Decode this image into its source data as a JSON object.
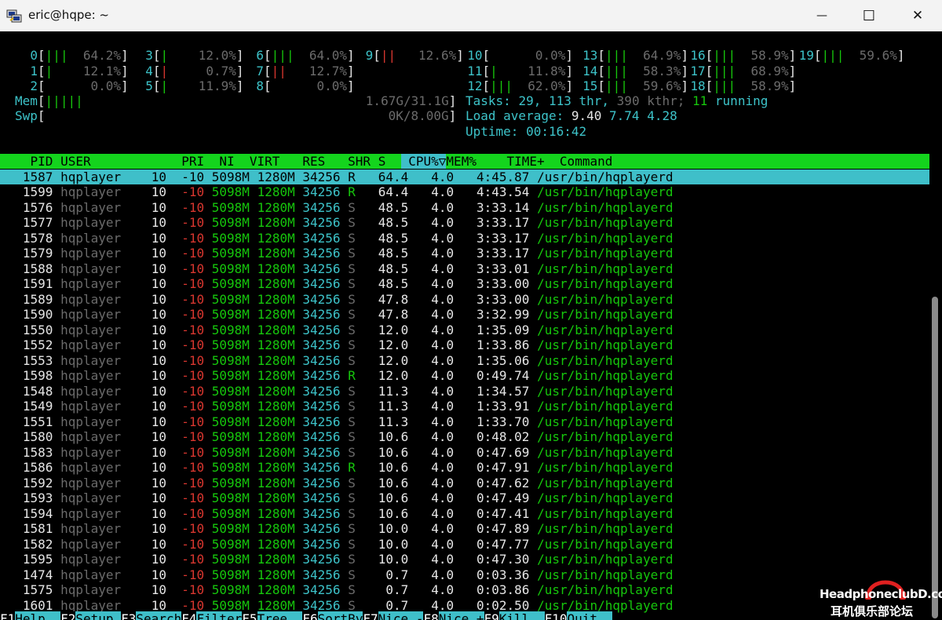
{
  "window": {
    "title": "eric@hqpe: ~",
    "minimize_glyph": "—",
    "maximize_glyph": "☐",
    "close_glyph": "✕",
    "app_icon": "putty-icon"
  },
  "meters": {
    "cpus": [
      {
        "id": "0",
        "bars": "|||",
        "pct": "64.2%"
      },
      {
        "id": "1",
        "bars": "|",
        "pct": "12.1%"
      },
      {
        "id": "2",
        "bars": "",
        "pct": "0.0%"
      },
      {
        "id": "3",
        "bars": "|",
        "pct": "12.0%"
      },
      {
        "id": "4",
        "bars": "|",
        "pct": "0.7%"
      },
      {
        "id": "5",
        "bars": "|",
        "pct": "11.9%"
      },
      {
        "id": "6",
        "bars": "|||",
        "pct": "64.0%"
      },
      {
        "id": "7",
        "bars": "||",
        "pct": "12.7%"
      },
      {
        "id": "8",
        "bars": "",
        "pct": "0.0%"
      },
      {
        "id": "9",
        "bars": "||",
        "pct": "12.6%"
      },
      {
        "id": "10",
        "bars": "",
        "pct": "0.0%"
      },
      {
        "id": "11",
        "bars": "|",
        "pct": "11.8%"
      },
      {
        "id": "12",
        "bars": "|||",
        "pct": "62.0%"
      },
      {
        "id": "13",
        "bars": "|||",
        "pct": "64.9%"
      },
      {
        "id": "14",
        "bars": "|||",
        "pct": "58.3%"
      },
      {
        "id": "15",
        "bars": "|||",
        "pct": "59.6%"
      },
      {
        "id": "16",
        "bars": "|||",
        "pct": "58.9%"
      },
      {
        "id": "17",
        "bars": "|||",
        "pct": "68.9%"
      },
      {
        "id": "18",
        "bars": "|||",
        "pct": "58.9%"
      },
      {
        "id": "19",
        "bars": "|||",
        "pct": "59.6%"
      }
    ],
    "mem": {
      "label": "Mem",
      "bars": "|||||",
      "value": "1.67G/31.1G"
    },
    "swp": {
      "label": "Swp",
      "bars": "",
      "value": "0K/8.00G"
    }
  },
  "summary": {
    "tasks_label": "Tasks: ",
    "tasks": "29",
    "sep1": ", ",
    "thr": "113",
    "thr_label": " thr, ",
    "kthr": "390",
    "kthr_label": " kthr; ",
    "running": "11",
    "running_label": " running",
    "load_label": "Load average: ",
    "load1": "9.40",
    "load5": "7.74",
    "load15": "4.28",
    "uptime_label": "Uptime: ",
    "uptime": "00:16:42"
  },
  "table": {
    "headers": {
      "pid": "PID",
      "user": "USER",
      "pri": "PRI",
      "ni": "NI",
      "virt": "VIRT",
      "res": "RES",
      "shr": "SHR",
      "s": "S",
      "cpu": "CPU%",
      "sort_arrow": "▽",
      "mem": "MEM%",
      "time": "TIME+",
      "command": "Command"
    },
    "rows": [
      {
        "pid": "1587",
        "user": "hqplayer",
        "pri": "10",
        "ni": "-10",
        "virt": "5098M",
        "res": "1280M",
        "shr": "34256",
        "s": "R",
        "cpu": "64.4",
        "mem": "4.0",
        "time": "4:45.87",
        "command": "/usr/bin/hqplayerd"
      },
      {
        "pid": "1599",
        "user": "hqplayer",
        "pri": "10",
        "ni": "-10",
        "virt": "5098M",
        "res": "1280M",
        "shr": "34256",
        "s": "R",
        "cpu": "64.4",
        "mem": "4.0",
        "time": "4:43.54",
        "command": "/usr/bin/hqplayerd"
      },
      {
        "pid": "1576",
        "user": "hqplayer",
        "pri": "10",
        "ni": "-10",
        "virt": "5098M",
        "res": "1280M",
        "shr": "34256",
        "s": "S",
        "cpu": "48.5",
        "mem": "4.0",
        "time": "3:33.14",
        "command": "/usr/bin/hqplayerd"
      },
      {
        "pid": "1577",
        "user": "hqplayer",
        "pri": "10",
        "ni": "-10",
        "virt": "5098M",
        "res": "1280M",
        "shr": "34256",
        "s": "S",
        "cpu": "48.5",
        "mem": "4.0",
        "time": "3:33.17",
        "command": "/usr/bin/hqplayerd"
      },
      {
        "pid": "1578",
        "user": "hqplayer",
        "pri": "10",
        "ni": "-10",
        "virt": "5098M",
        "res": "1280M",
        "shr": "34256",
        "s": "S",
        "cpu": "48.5",
        "mem": "4.0",
        "time": "3:33.17",
        "command": "/usr/bin/hqplayerd"
      },
      {
        "pid": "1579",
        "user": "hqplayer",
        "pri": "10",
        "ni": "-10",
        "virt": "5098M",
        "res": "1280M",
        "shr": "34256",
        "s": "S",
        "cpu": "48.5",
        "mem": "4.0",
        "time": "3:33.17",
        "command": "/usr/bin/hqplayerd"
      },
      {
        "pid": "1588",
        "user": "hqplayer",
        "pri": "10",
        "ni": "-10",
        "virt": "5098M",
        "res": "1280M",
        "shr": "34256",
        "s": "S",
        "cpu": "48.5",
        "mem": "4.0",
        "time": "3:33.01",
        "command": "/usr/bin/hqplayerd"
      },
      {
        "pid": "1591",
        "user": "hqplayer",
        "pri": "10",
        "ni": "-10",
        "virt": "5098M",
        "res": "1280M",
        "shr": "34256",
        "s": "S",
        "cpu": "48.5",
        "mem": "4.0",
        "time": "3:33.00",
        "command": "/usr/bin/hqplayerd"
      },
      {
        "pid": "1589",
        "user": "hqplayer",
        "pri": "10",
        "ni": "-10",
        "virt": "5098M",
        "res": "1280M",
        "shr": "34256",
        "s": "S",
        "cpu": "47.8",
        "mem": "4.0",
        "time": "3:33.00",
        "command": "/usr/bin/hqplayerd"
      },
      {
        "pid": "1590",
        "user": "hqplayer",
        "pri": "10",
        "ni": "-10",
        "virt": "5098M",
        "res": "1280M",
        "shr": "34256",
        "s": "S",
        "cpu": "47.8",
        "mem": "4.0",
        "time": "3:32.99",
        "command": "/usr/bin/hqplayerd"
      },
      {
        "pid": "1550",
        "user": "hqplayer",
        "pri": "10",
        "ni": "-10",
        "virt": "5098M",
        "res": "1280M",
        "shr": "34256",
        "s": "S",
        "cpu": "12.0",
        "mem": "4.0",
        "time": "1:35.09",
        "command": "/usr/bin/hqplayerd"
      },
      {
        "pid": "1552",
        "user": "hqplayer",
        "pri": "10",
        "ni": "-10",
        "virt": "5098M",
        "res": "1280M",
        "shr": "34256",
        "s": "S",
        "cpu": "12.0",
        "mem": "4.0",
        "time": "1:33.86",
        "command": "/usr/bin/hqplayerd"
      },
      {
        "pid": "1553",
        "user": "hqplayer",
        "pri": "10",
        "ni": "-10",
        "virt": "5098M",
        "res": "1280M",
        "shr": "34256",
        "s": "S",
        "cpu": "12.0",
        "mem": "4.0",
        "time": "1:35.06",
        "command": "/usr/bin/hqplayerd"
      },
      {
        "pid": "1598",
        "user": "hqplayer",
        "pri": "10",
        "ni": "-10",
        "virt": "5098M",
        "res": "1280M",
        "shr": "34256",
        "s": "R",
        "cpu": "12.0",
        "mem": "4.0",
        "time": "0:49.74",
        "command": "/usr/bin/hqplayerd"
      },
      {
        "pid": "1548",
        "user": "hqplayer",
        "pri": "10",
        "ni": "-10",
        "virt": "5098M",
        "res": "1280M",
        "shr": "34256",
        "s": "S",
        "cpu": "11.3",
        "mem": "4.0",
        "time": "1:34.57",
        "command": "/usr/bin/hqplayerd"
      },
      {
        "pid": "1549",
        "user": "hqplayer",
        "pri": "10",
        "ni": "-10",
        "virt": "5098M",
        "res": "1280M",
        "shr": "34256",
        "s": "S",
        "cpu": "11.3",
        "mem": "4.0",
        "time": "1:33.91",
        "command": "/usr/bin/hqplayerd"
      },
      {
        "pid": "1551",
        "user": "hqplayer",
        "pri": "10",
        "ni": "-10",
        "virt": "5098M",
        "res": "1280M",
        "shr": "34256",
        "s": "S",
        "cpu": "11.3",
        "mem": "4.0",
        "time": "1:33.70",
        "command": "/usr/bin/hqplayerd"
      },
      {
        "pid": "1580",
        "user": "hqplayer",
        "pri": "10",
        "ni": "-10",
        "virt": "5098M",
        "res": "1280M",
        "shr": "34256",
        "s": "S",
        "cpu": "10.6",
        "mem": "4.0",
        "time": "0:48.02",
        "command": "/usr/bin/hqplayerd"
      },
      {
        "pid": "1583",
        "user": "hqplayer",
        "pri": "10",
        "ni": "-10",
        "virt": "5098M",
        "res": "1280M",
        "shr": "34256",
        "s": "S",
        "cpu": "10.6",
        "mem": "4.0",
        "time": "0:47.69",
        "command": "/usr/bin/hqplayerd"
      },
      {
        "pid": "1586",
        "user": "hqplayer",
        "pri": "10",
        "ni": "-10",
        "virt": "5098M",
        "res": "1280M",
        "shr": "34256",
        "s": "R",
        "cpu": "10.6",
        "mem": "4.0",
        "time": "0:47.91",
        "command": "/usr/bin/hqplayerd"
      },
      {
        "pid": "1592",
        "user": "hqplayer",
        "pri": "10",
        "ni": "-10",
        "virt": "5098M",
        "res": "1280M",
        "shr": "34256",
        "s": "S",
        "cpu": "10.6",
        "mem": "4.0",
        "time": "0:47.62",
        "command": "/usr/bin/hqplayerd"
      },
      {
        "pid": "1593",
        "user": "hqplayer",
        "pri": "10",
        "ni": "-10",
        "virt": "5098M",
        "res": "1280M",
        "shr": "34256",
        "s": "S",
        "cpu": "10.6",
        "mem": "4.0",
        "time": "0:47.49",
        "command": "/usr/bin/hqplayerd"
      },
      {
        "pid": "1594",
        "user": "hqplayer",
        "pri": "10",
        "ni": "-10",
        "virt": "5098M",
        "res": "1280M",
        "shr": "34256",
        "s": "S",
        "cpu": "10.6",
        "mem": "4.0",
        "time": "0:47.41",
        "command": "/usr/bin/hqplayerd"
      },
      {
        "pid": "1581",
        "user": "hqplayer",
        "pri": "10",
        "ni": "-10",
        "virt": "5098M",
        "res": "1280M",
        "shr": "34256",
        "s": "S",
        "cpu": "10.0",
        "mem": "4.0",
        "time": "0:47.89",
        "command": "/usr/bin/hqplayerd"
      },
      {
        "pid": "1582",
        "user": "hqplayer",
        "pri": "10",
        "ni": "-10",
        "virt": "5098M",
        "res": "1280M",
        "shr": "34256",
        "s": "S",
        "cpu": "10.0",
        "mem": "4.0",
        "time": "0:47.77",
        "command": "/usr/bin/hqplayerd"
      },
      {
        "pid": "1595",
        "user": "hqplayer",
        "pri": "10",
        "ni": "-10",
        "virt": "5098M",
        "res": "1280M",
        "shr": "34256",
        "s": "S",
        "cpu": "10.0",
        "mem": "4.0",
        "time": "0:47.30",
        "command": "/usr/bin/hqplayerd"
      },
      {
        "pid": "1474",
        "user": "hqplayer",
        "pri": "10",
        "ni": "-10",
        "virt": "5098M",
        "res": "1280M",
        "shr": "34256",
        "s": "S",
        "cpu": "0.7",
        "mem": "4.0",
        "time": "0:03.36",
        "command": "/usr/bin/hqplayerd"
      },
      {
        "pid": "1575",
        "user": "hqplayer",
        "pri": "10",
        "ni": "-10",
        "virt": "5098M",
        "res": "1280M",
        "shr": "34256",
        "s": "S",
        "cpu": "0.7",
        "mem": "4.0",
        "time": "0:03.86",
        "command": "/usr/bin/hqplayerd"
      },
      {
        "pid": "1601",
        "user": "hqplayer",
        "pri": "10",
        "ni": "-10",
        "virt": "5098M",
        "res": "1280M",
        "shr": "34256",
        "s": "S",
        "cpu": "0.7",
        "mem": "4.0",
        "time": "0:02.50",
        "command": "/usr/bin/hqplayerd"
      }
    ]
  },
  "function_keys": [
    {
      "key": "F1",
      "label": "Help"
    },
    {
      "key": "F2",
      "label": "Setup"
    },
    {
      "key": "F3",
      "label": "Search"
    },
    {
      "key": "F4",
      "label": "Filter"
    },
    {
      "key": "F5",
      "label": "Tree"
    },
    {
      "key": "F6",
      "label": "SortBy"
    },
    {
      "key": "F7",
      "label": "Nice -"
    },
    {
      "key": "F8",
      "label": "Nice +"
    },
    {
      "key": "F9",
      "label": "Kill"
    },
    {
      "key": "F10",
      "label": "Quit"
    }
  ],
  "watermark": {
    "line1": "HeadphoneclubD.com",
    "line2": "耳机俱乐部论坛"
  },
  "colors": {
    "terminal_bg": "#000000",
    "cyan": "#3dc3c9",
    "green": "#16c60c",
    "header_green": "#14d41d",
    "gray": "#6b6b6b",
    "red": "#d8362f"
  }
}
